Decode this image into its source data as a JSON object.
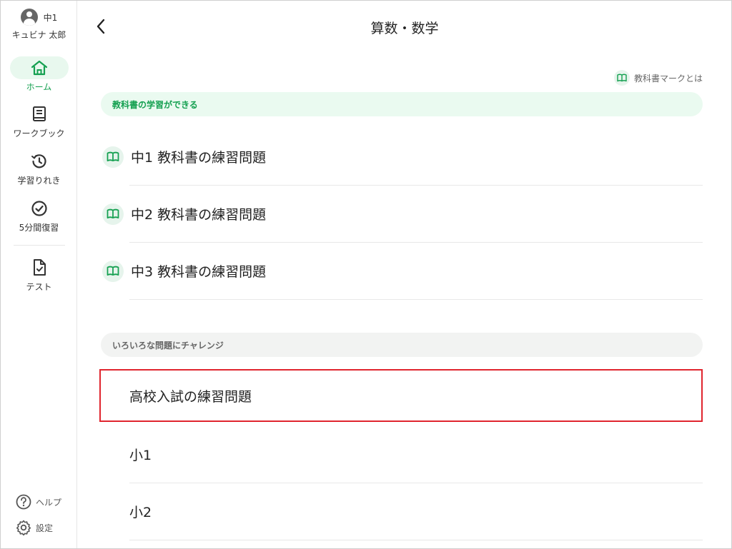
{
  "sidebar": {
    "user": {
      "grade": "中1",
      "name": "キュビナ 太郎"
    },
    "nav": [
      {
        "label": "ホーム",
        "icon": "home-icon",
        "active": true
      },
      {
        "label": "ワークブック",
        "icon": "book-icon",
        "active": false
      },
      {
        "label": "学習りれき",
        "icon": "history-icon",
        "active": false
      },
      {
        "label": "5分間復習",
        "icon": "check-circle-icon",
        "active": false
      },
      {
        "label": "テスト",
        "icon": "test-doc-icon",
        "active": false
      }
    ],
    "help_label": "ヘルプ",
    "settings_label": "設定"
  },
  "header": {
    "title": "算数・数学",
    "back_icon": "chevron-left-icon"
  },
  "textbook_mark_label": "教科書マークとは",
  "sections": {
    "textbook": {
      "title": "教科書の学習ができる",
      "items": [
        {
          "label": "中1 教科書の練習問題"
        },
        {
          "label": "中2 教科書の練習問題"
        },
        {
          "label": "中3 教科書の練習問題"
        }
      ]
    },
    "challenge": {
      "title": "いろいろな問題にチャレンジ",
      "items": [
        {
          "label": "高校入試の練習問題",
          "highlighted": true
        },
        {
          "label": "小1"
        },
        {
          "label": "小2"
        }
      ]
    }
  },
  "colors": {
    "accent": "#14a050",
    "accent_bg": "#eafaf0",
    "highlight": "#e0252e"
  }
}
